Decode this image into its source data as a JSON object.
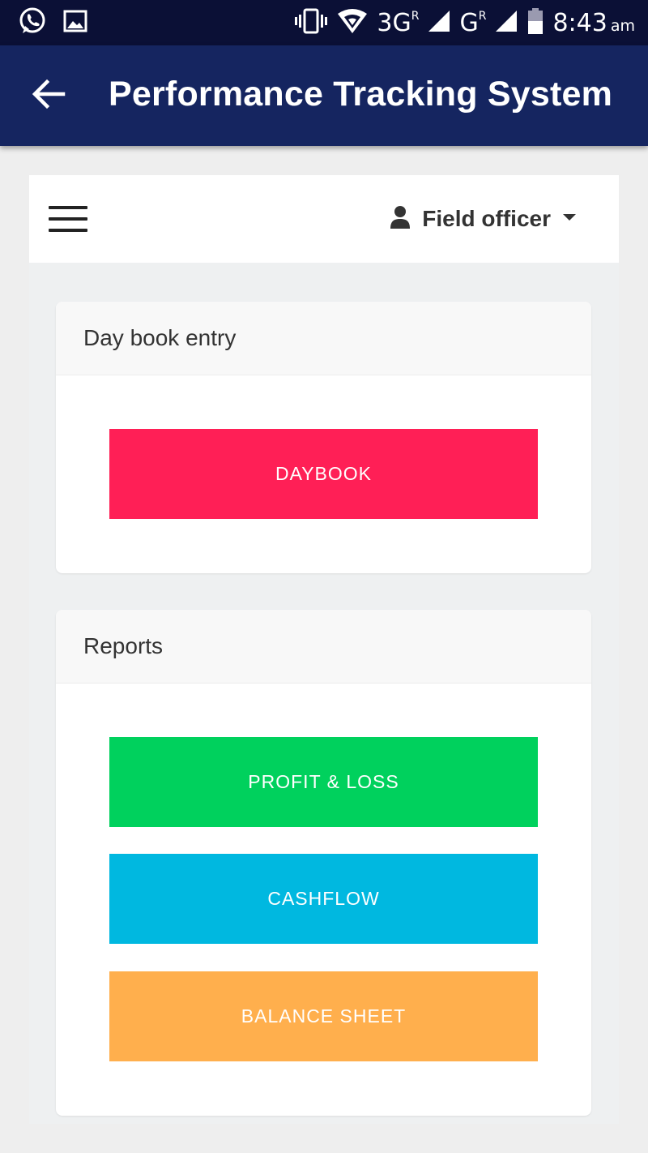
{
  "status_bar": {
    "icons": [
      "whatsapp-icon",
      "image-icon",
      "vibrate-icon",
      "wifi-icon",
      "signal-icon",
      "signal-icon",
      "battery-icon"
    ],
    "network_1": "3G",
    "network_1_sup": "R",
    "network_2": "G",
    "network_2_sup": "R",
    "time": "8:43",
    "ampm": "am"
  },
  "app_bar": {
    "title": "Performance Tracking System",
    "back_icon": "arrow-left-icon"
  },
  "topnav": {
    "menu_icon": "hamburger-icon",
    "user_icon": "user-icon",
    "user_name": "Field officer",
    "dropdown_icon": "caret-down-icon"
  },
  "daybook_card": {
    "header": "Day book entry",
    "button_label": "DAYBOOK",
    "button_color": "#ff1f56"
  },
  "reports_card": {
    "header": "Reports",
    "buttons": [
      {
        "label": "PROFIT & LOSS",
        "color": "#00d15d"
      },
      {
        "label": "CASHFLOW",
        "color": "#00b8e0"
      },
      {
        "label": "BALANCE SHEET",
        "color": "#ffaf4d"
      }
    ]
  },
  "colors": {
    "status_bar": "#0b1036",
    "app_bar": "#152560",
    "page_background": "#eeeeee"
  }
}
